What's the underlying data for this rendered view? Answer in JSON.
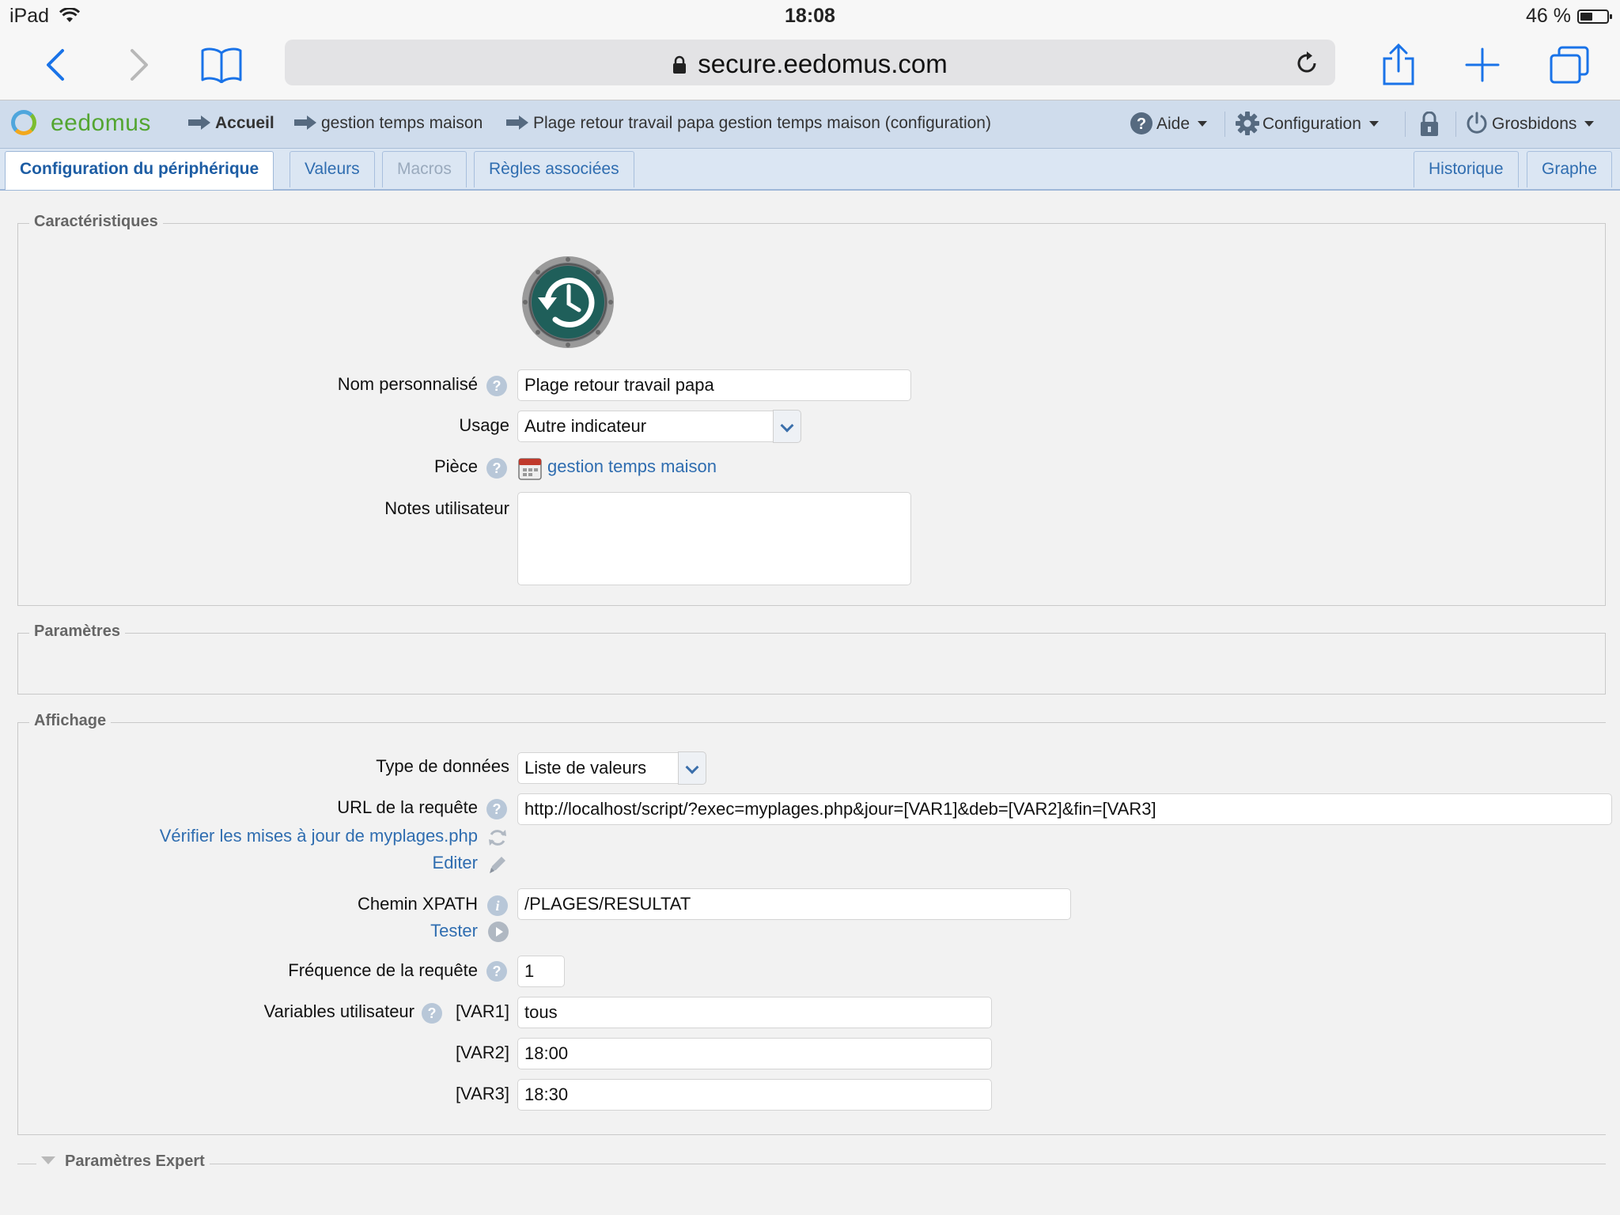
{
  "status_bar": {
    "device": "iPad",
    "time": "18:08",
    "battery": "46 %",
    "battery_level": 0.46
  },
  "browser": {
    "url": "secure.eedomus.com"
  },
  "app": {
    "logo": "eedomus",
    "breadcrumbs": [
      "Accueil",
      "gestion temps maison",
      "Plage retour travail papa gestion temps maison (configuration)"
    ],
    "menu": {
      "help": "Aide",
      "configuration": "Configuration",
      "user": "Grosbidons"
    }
  },
  "tabs": {
    "items": [
      "Configuration du périphérique",
      "Valeurs",
      "Macros",
      "Règles associées"
    ],
    "right": [
      "Historique",
      "Graphe"
    ]
  },
  "caracteristiques": {
    "legend": "Caractéristiques",
    "nom_label": "Nom personnalisé",
    "nom_value": "Plage retour travail papa",
    "usage_label": "Usage",
    "usage_value": "Autre indicateur",
    "piece_label": "Pièce",
    "piece_value": "gestion temps maison",
    "notes_label": "Notes utilisateur",
    "notes_value": ""
  },
  "parametres": {
    "legend": "Paramètres"
  },
  "affichage": {
    "legend": "Affichage",
    "type_label": "Type de données",
    "type_value": "Liste de valeurs",
    "url_label": "URL de la requête",
    "url_value": "http://localhost/script/?exec=myplages.php&jour=[VAR1]&deb=[VAR2]&fin=[VAR3]",
    "verify_link": "Vérifier les mises à jour de myplages.php",
    "edit_link": "Editer",
    "xpath_label": "Chemin XPATH",
    "xpath_value": "/PLAGES/RESULTAT",
    "test_link": "Tester",
    "freq_label": "Fréquence de la requête",
    "freq_value": "1",
    "vars_label": "Variables utilisateur",
    "var1_label": "[VAR1]",
    "var1_value": "tous",
    "var2_label": "[VAR2]",
    "var2_value": "18:00",
    "var3_label": "[VAR3]",
    "var3_value": "18:30"
  },
  "expert": {
    "legend": "Paramètres Expert"
  }
}
